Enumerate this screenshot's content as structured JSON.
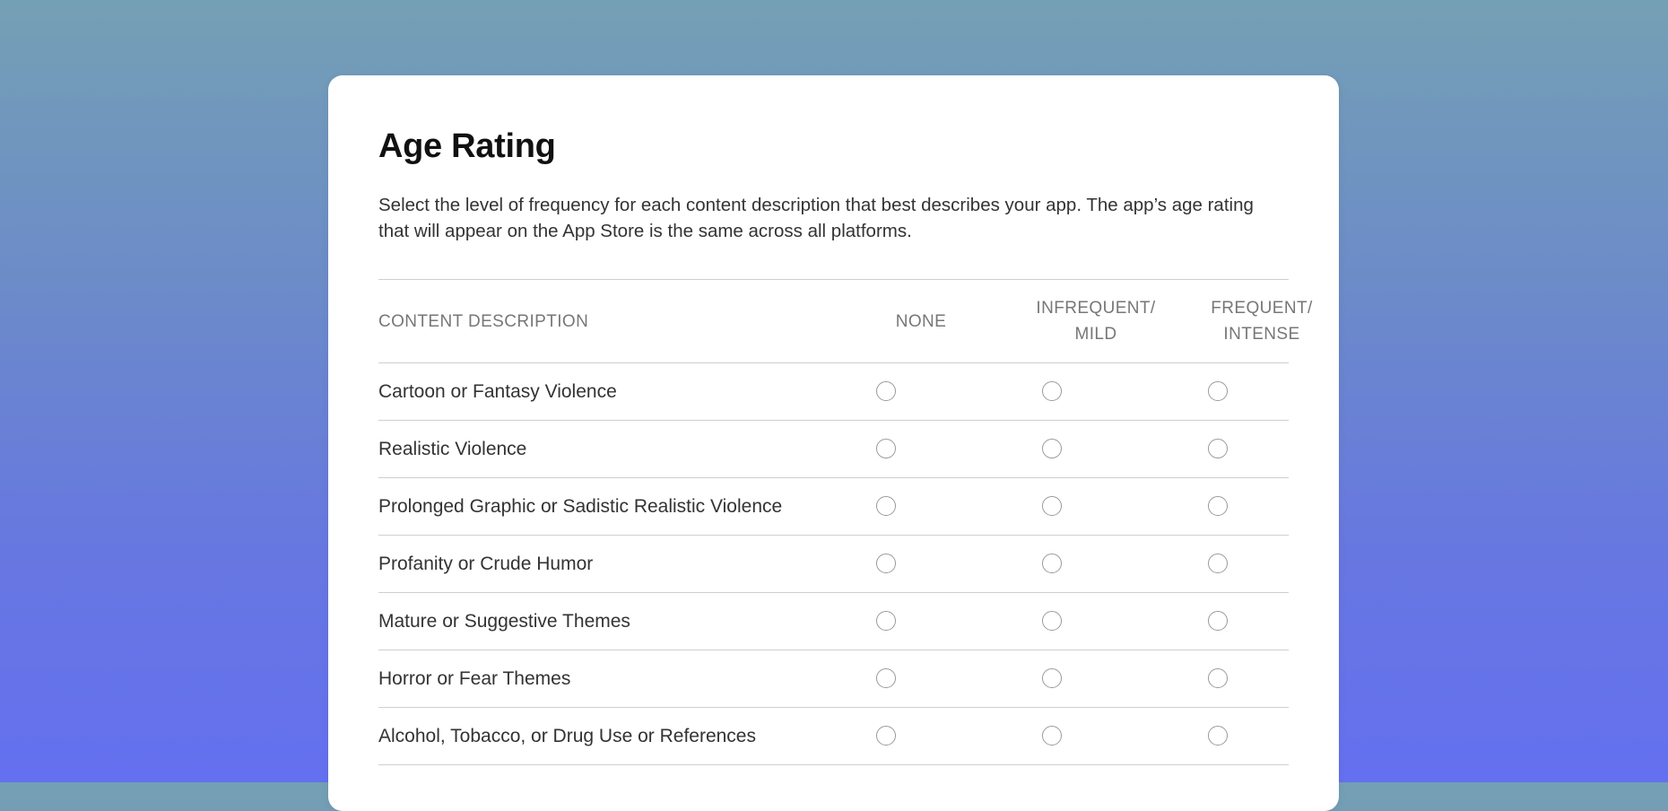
{
  "page": {
    "title": "Age Rating",
    "description": "Select the level of frequency for each content description that best describes your app. The app’s age rating that will appear on the App Store is the same across all platforms."
  },
  "table": {
    "headers": {
      "description": "CONTENT DESCRIPTION",
      "none": "NONE",
      "mild": "INFREQUENT/\nMILD",
      "intense": "FREQUENT/\nINTENSE"
    },
    "rows": [
      {
        "label": "Cartoon or Fantasy Violence",
        "selected": null
      },
      {
        "label": "Realistic Violence",
        "selected": null
      },
      {
        "label": "Prolonged Graphic or Sadistic Realistic Violence",
        "selected": null
      },
      {
        "label": "Profanity or Crude Humor",
        "selected": null
      },
      {
        "label": "Mature or Suggestive Themes",
        "selected": null
      },
      {
        "label": "Horror or Fear Themes",
        "selected": null
      },
      {
        "label": "Alcohol, Tobacco, or Drug Use or References",
        "selected": null
      }
    ]
  },
  "colors": {
    "background_top": "#74a0b4",
    "background_bottom": "#6470f0",
    "card": "#ffffff",
    "divider": "#cfcfcf",
    "radio_border": "#9a9a9a"
  },
  "icons": {
    "radio": "radio-unchecked-icon"
  }
}
